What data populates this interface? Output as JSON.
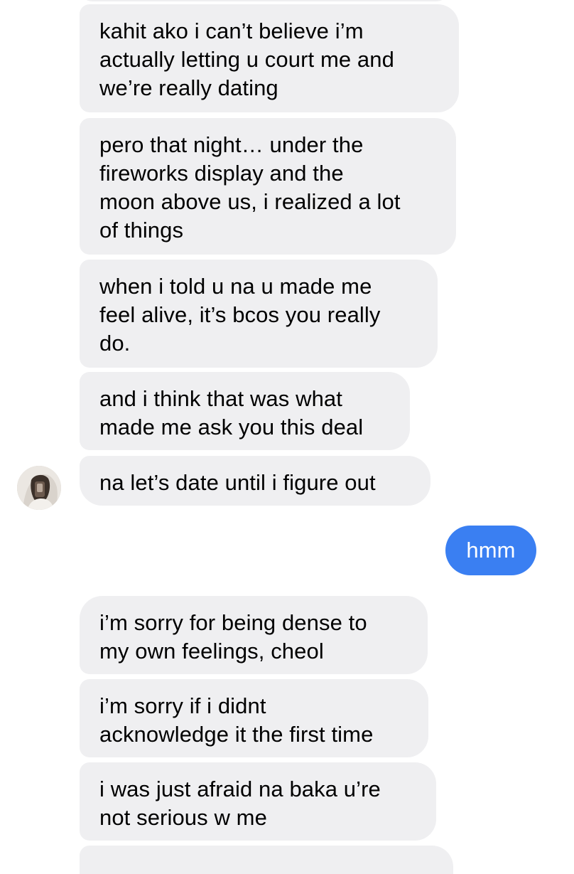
{
  "conversation": {
    "messages": [
      {
        "from": "them",
        "text": "kahit ako i can’t believe i’m\nactually letting u court me and\nwe’re really dating"
      },
      {
        "from": "them",
        "text": "pero that night… under the\nfireworks display and the\nmoon above us, i realized a lot\nof things"
      },
      {
        "from": "them",
        "text": "when i told u na u made me\nfeel alive, it’s bcos you really\ndo."
      },
      {
        "from": "them",
        "text": "and i think that was what\nmade me ask you this deal"
      },
      {
        "from": "them",
        "text": "na let’s date until i figure out"
      },
      {
        "from": "me",
        "text": "hmm"
      },
      {
        "from": "them",
        "text": "i’m sorry for being dense to\nmy own feelings, cheol"
      },
      {
        "from": "them",
        "text": "i’m sorry if i didnt\nacknowledge it the first time"
      },
      {
        "from": "them",
        "text": "i was just afraid na baka u’re\nnot serious w me"
      }
    ],
    "avatar_icon": "contact-avatar-photo",
    "colors": {
      "incoming_bubble": "#efeff1",
      "outgoing_bubble": "#3a7ff2",
      "outgoing_text": "#ffffff",
      "incoming_text": "#000000"
    }
  }
}
